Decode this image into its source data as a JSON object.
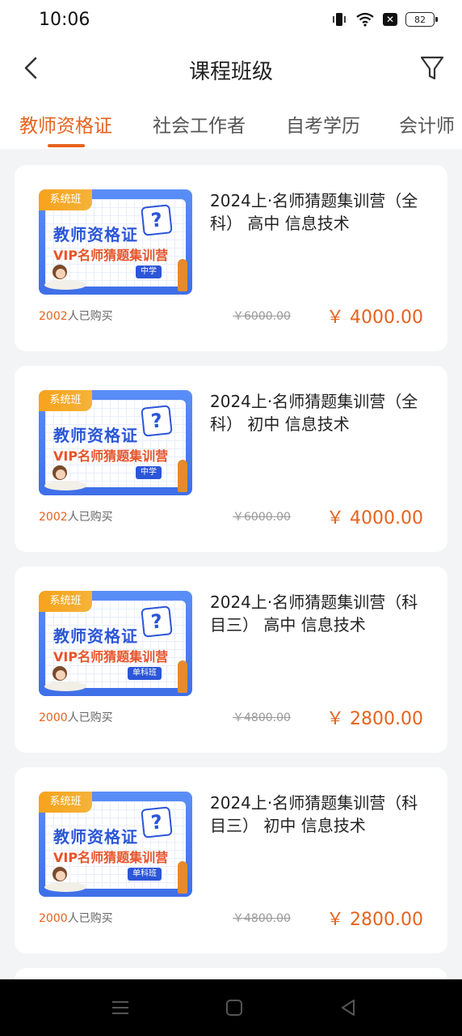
{
  "status_bar": {
    "time": "10:06",
    "battery": "82",
    "icons": [
      "vibrate-icon",
      "wifi-icon",
      "no-sim-icon",
      "battery-icon"
    ]
  },
  "nav": {
    "title": "课程班级",
    "back_icon": "chevron-left-icon",
    "filter_icon": "filter-icon"
  },
  "tabs": [
    {
      "label": "教师资格证",
      "active": true
    },
    {
      "label": "社会工作者",
      "active": false
    },
    {
      "label": "自考学历",
      "active": false
    },
    {
      "label": "会计师",
      "active": false
    }
  ],
  "courses": [
    {
      "badge": "系统班",
      "thumb_line1": "教师资格证",
      "thumb_line2": "VIP名师猜题集训营",
      "thumb_tag": "中学",
      "title": "2024上·名师猜题集训营（全科） 高中 信息技术",
      "buyers_count": "2002",
      "buyers_suffix": "人已购买",
      "original_price": "￥6000.00",
      "price": "￥ 4000.00"
    },
    {
      "badge": "系统班",
      "thumb_line1": "教师资格证",
      "thumb_line2": "VIP名师猜题集训营",
      "thumb_tag": "中学",
      "title": "2024上·名师猜题集训营（全科） 初中 信息技术",
      "buyers_count": "2002",
      "buyers_suffix": "人已购买",
      "original_price": "￥6000.00",
      "price": "￥ 4000.00"
    },
    {
      "badge": "系统班",
      "thumb_line1": "教师资格证",
      "thumb_line2": "VIP名师猜题集训营",
      "thumb_tag": "单科班",
      "title": "2024上·名师猜题集训营（科目三） 高中 信息技术",
      "buyers_count": "2000",
      "buyers_suffix": "人已购买",
      "original_price": "￥4800.00",
      "price": "￥ 2800.00"
    },
    {
      "badge": "系统班",
      "thumb_line1": "教师资格证",
      "thumb_line2": "VIP名师猜题集训营",
      "thumb_tag": "单科班",
      "title": "2024上·名师猜题集训营（科目三） 初中 信息技术",
      "buyers_count": "2000",
      "buyers_suffix": "人已购买",
      "original_price": "￥4800.00",
      "price": "￥ 2800.00"
    }
  ],
  "system_nav": [
    "menu-icon",
    "home-icon",
    "back-triangle-icon"
  ],
  "colors": {
    "accent": "#e5631f",
    "background": "#f3f4f6"
  }
}
